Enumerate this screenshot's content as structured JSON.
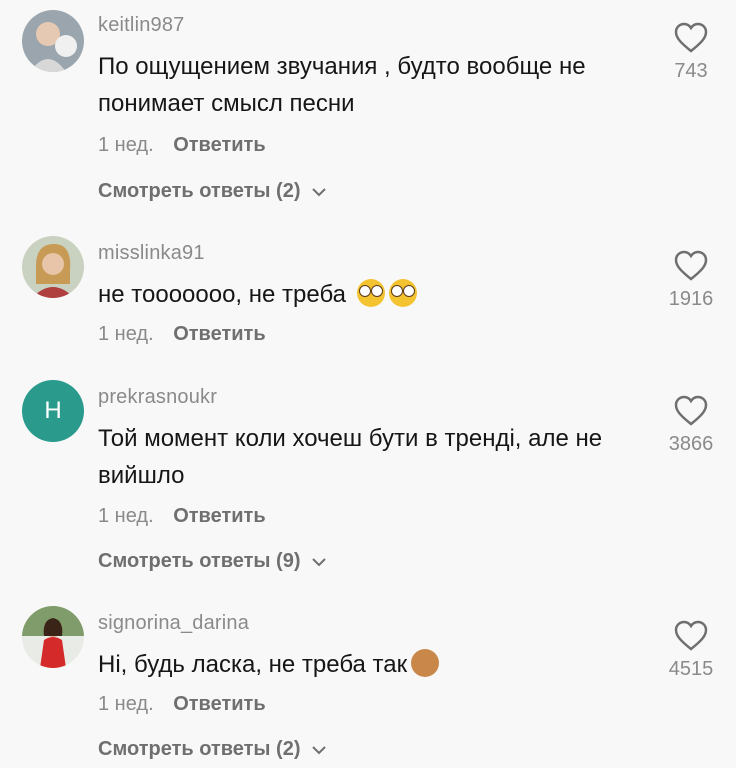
{
  "comments": [
    {
      "username": "keitlin987",
      "text": "По ощущением звучания , будто вообще не понимает смысл песни",
      "time": "1 нед.",
      "reply_label": "Ответить",
      "likes": "743",
      "view_replies": "Смотреть ответы (2)",
      "avatar_icon": "user-photo-icon"
    },
    {
      "username": "misslinka91",
      "text": "не тоооoooo, не треба",
      "emoji": [
        "flushed-face-emoji",
        "flushed-face-emoji"
      ],
      "time": "1 нед.",
      "reply_label": "Ответить",
      "likes": "1916",
      "avatar_icon": "user-photo-icon"
    },
    {
      "username": "prekrasnoukr",
      "text": "Той момент коли хочеш бути в тренді, але не вийшло",
      "time": "1 нед.",
      "reply_label": "Ответить",
      "likes": "3866",
      "view_replies": "Смотреть ответы (9)",
      "avatar_letter": "H",
      "avatar_color": "#2a9a8c"
    },
    {
      "username": "signorina_darina",
      "text": "Ні, будь ласка, не треба так",
      "emoji": [
        "see-no-evil-monkey-emoji"
      ],
      "time": "1 нед.",
      "reply_label": "Ответить",
      "likes": "4515",
      "view_replies": "Смотреть ответы (2)",
      "avatar_icon": "user-photo-icon"
    }
  ],
  "icons": {
    "like": "heart-outline-icon",
    "expand": "chevron-down-icon"
  }
}
